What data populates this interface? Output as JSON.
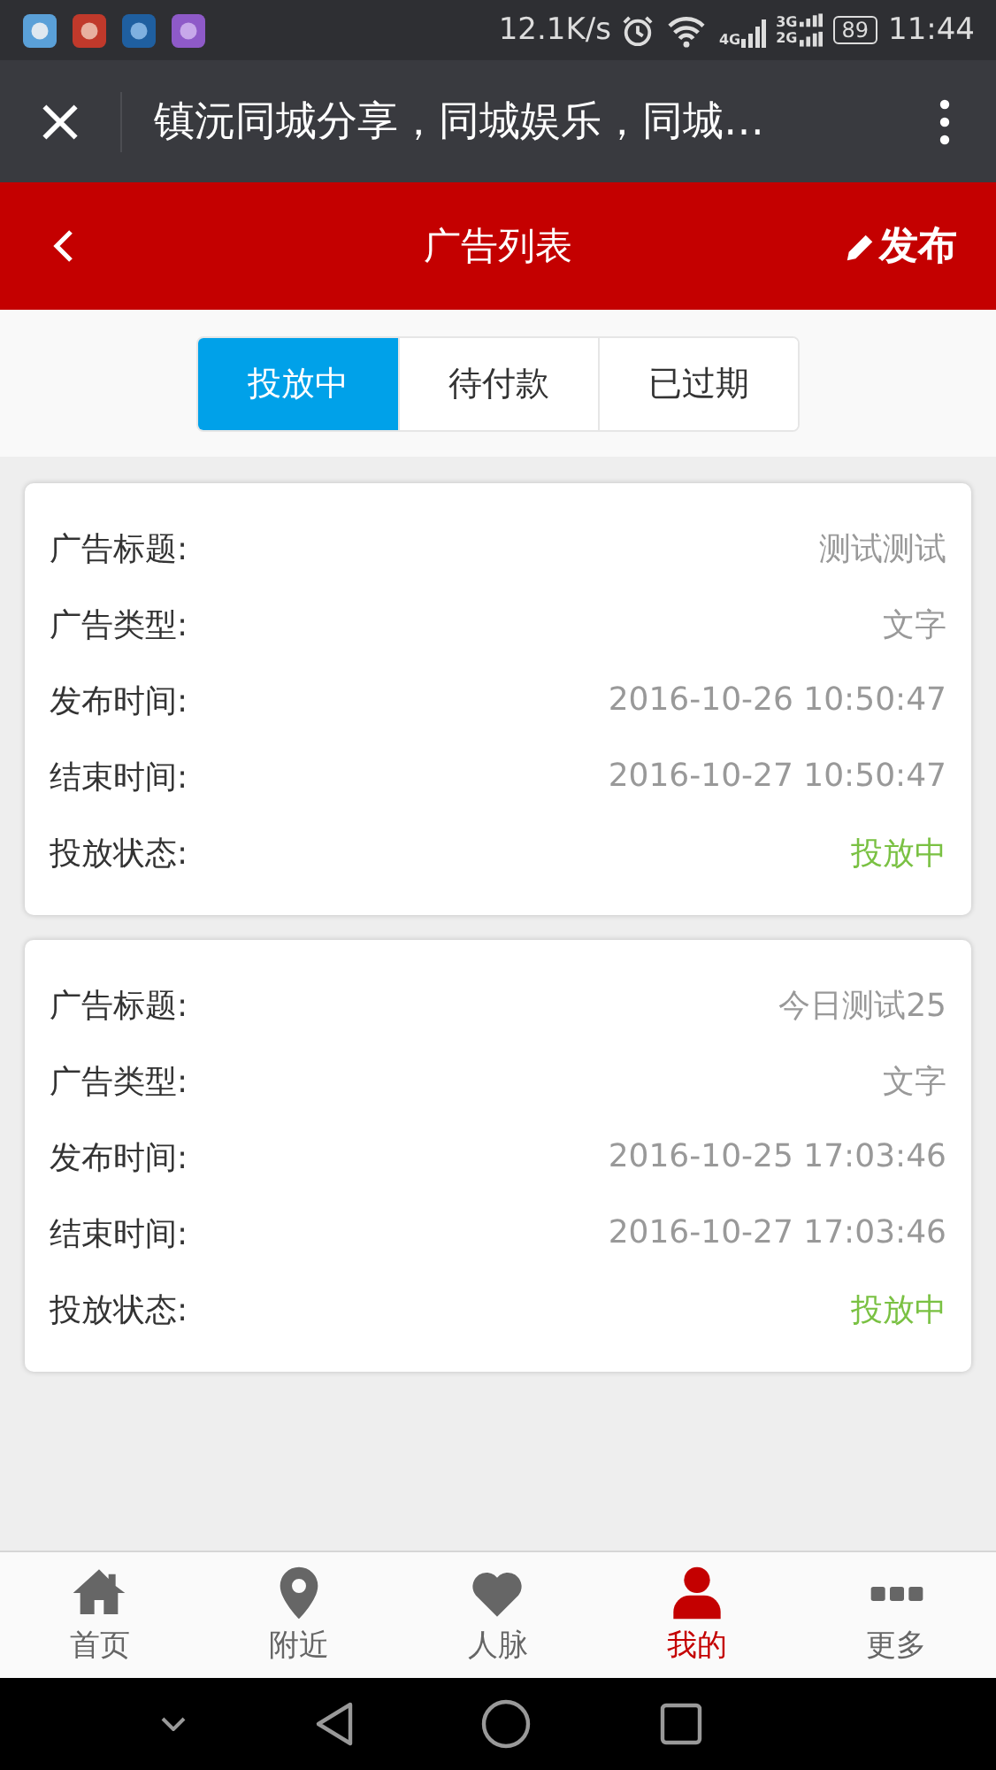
{
  "status_bar": {
    "speed": "12.1K/s",
    "network_4g": "4G",
    "network_3g": "3G",
    "network_2g": "2G",
    "battery": "89",
    "time": "11:44"
  },
  "browser_bar": {
    "title": "镇沅同城分享，同城娱乐，同城…"
  },
  "header": {
    "title": "广告列表",
    "action": "发布"
  },
  "tabs": [
    {
      "label": "投放中",
      "selected": true
    },
    {
      "label": "待付款",
      "selected": false
    },
    {
      "label": "已过期",
      "selected": false
    }
  ],
  "ads": [
    {
      "rows": [
        {
          "kind": "plain",
          "label": "广告标题:",
          "value": "测试测试"
        },
        {
          "kind": "plain",
          "label": "广告类型:",
          "value": "文字"
        },
        {
          "kind": "plain",
          "label": "发布时间:",
          "value": "2016-10-26 10:50:47"
        },
        {
          "kind": "plain",
          "label": "结束时间:",
          "value": "2016-10-27 10:50:47"
        },
        {
          "kind": "status",
          "label": "投放状态:",
          "value": "投放中"
        }
      ]
    },
    {
      "rows": [
        {
          "kind": "plain",
          "label": "广告标题:",
          "value": "今日测试25"
        },
        {
          "kind": "plain",
          "label": "广告类型:",
          "value": "文字"
        },
        {
          "kind": "plain",
          "label": "发布时间:",
          "value": "2016-10-25 17:03:46"
        },
        {
          "kind": "plain",
          "label": "结束时间:",
          "value": "2016-10-27 17:03:46"
        },
        {
          "kind": "status",
          "label": "投放状态:",
          "value": "投放中"
        }
      ]
    }
  ],
  "bottom_nav": [
    {
      "kind": "home",
      "label": "首页",
      "selected": false
    },
    {
      "kind": "pin",
      "label": "附近",
      "selected": false
    },
    {
      "kind": "heart",
      "label": "人脉",
      "selected": false
    },
    {
      "kind": "person",
      "label": "我的",
      "selected": true
    },
    {
      "kind": "more",
      "label": "更多",
      "selected": false
    }
  ]
}
